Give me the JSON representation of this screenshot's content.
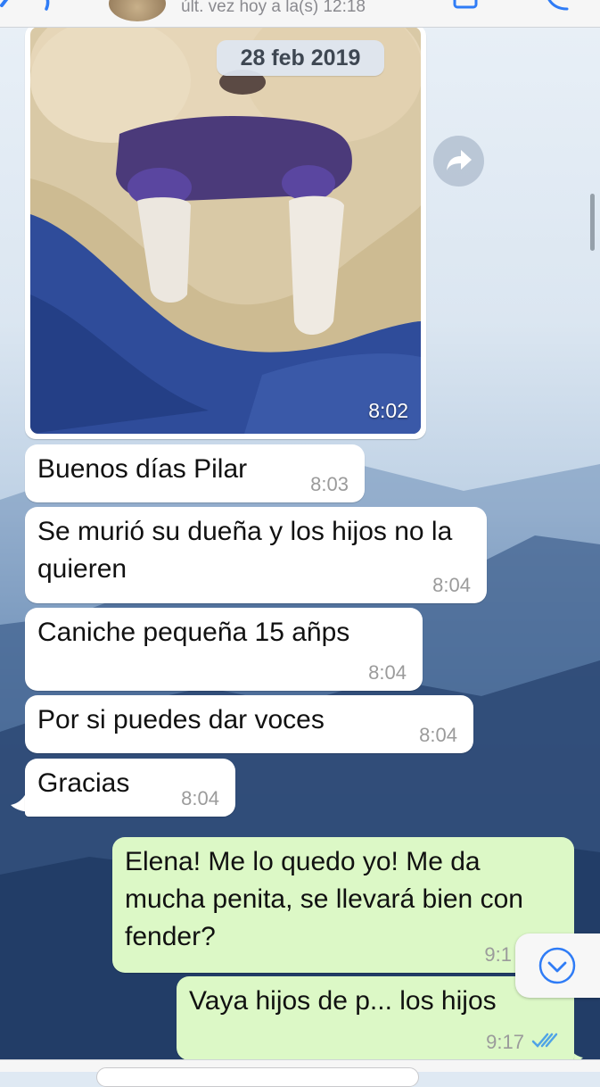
{
  "header": {
    "status": "últ. vez hoy a la(s) 12:18"
  },
  "chat": {
    "date_label": "28 feb 2019",
    "photo_time": "8:02",
    "messages": [
      {
        "text": "Buenos días Pilar",
        "time": "8:03",
        "direction": "incoming"
      },
      {
        "text": "Se murió su dueña y los hijos no la quieren",
        "time": "8:04",
        "direction": "incoming"
      },
      {
        "text": "Caniche pequeña 15 añps",
        "time": "8:04",
        "direction": "incoming"
      },
      {
        "text": "Por si puedes dar voces",
        "time": "8:04",
        "direction": "incoming"
      },
      {
        "text": "Gracias",
        "time": "8:04",
        "direction": "incoming"
      },
      {
        "text": "Elena! Me lo quedo yo! Me da mucha penita, se llevará bien con fender?",
        "time": "9:1",
        "direction": "outgoing"
      },
      {
        "text": "Vaya hijos de p... los hijos",
        "time": "9:17",
        "direction": "outgoing",
        "status": "read"
      }
    ]
  },
  "icons": {
    "back": "chevron-left-icon",
    "video": "video-camera-icon",
    "call": "phone-icon",
    "forward": "forward-icon",
    "scroll_down": "chevron-down-icon",
    "read_receipt": "double-check-icon"
  },
  "colors": {
    "accent": "#2f7cf6",
    "incoming_bubble": "#ffffff",
    "outgoing_bubble": "#dcf8c6",
    "read_ticks": "#4fa3e6"
  }
}
